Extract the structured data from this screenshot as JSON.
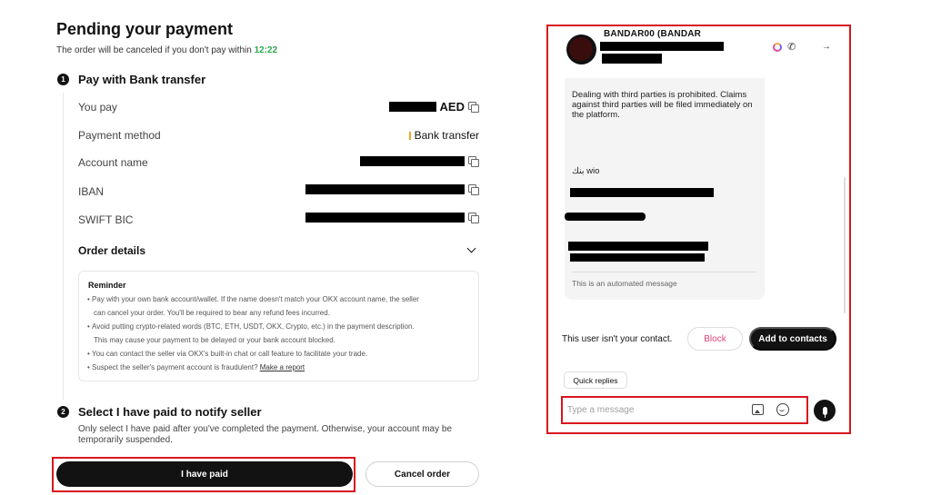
{
  "header": {
    "title": "Pending your payment",
    "subtitle_prefix": "The order will be canceled if you don't pay within",
    "countdown": "12:22"
  },
  "step1": {
    "number": "1",
    "title": "Pay with Bank transfer",
    "rows": {
      "you_pay": {
        "label": "You pay",
        "value_suffix": "AED"
      },
      "payment_method": {
        "label": "Payment method",
        "value": "Bank transfer"
      },
      "account_name": {
        "label": "Account name"
      },
      "iban": {
        "label": "IBAN"
      },
      "swift": {
        "label": "SWIFT BIC"
      }
    },
    "order_details": "Order details"
  },
  "reminder": {
    "title": "Reminder",
    "items": [
      "Pay with your own bank account/wallet. If the name doesn't match your OKX account name, the seller",
      "can cancel your order. You'll be required to bear any refund fees incurred.",
      "Avoid putting crypto-related words (BTC, ETH, USDT, OKX, Crypto, etc.) in the payment description.",
      "This may cause your payment to be delayed or your bank account blocked.",
      "You can contact the seller via OKX's built-in chat or call feature to facilitate your trade.",
      "Suspect the seller's payment account is fraudulent?"
    ],
    "report_link": "Make a report"
  },
  "step2": {
    "number": "2",
    "title": "Select I have paid to notify seller",
    "description": "Only select I have paid after you've completed the payment. Otherwise, your account may be temporarily suspended."
  },
  "actions": {
    "paid": "I have paid",
    "cancel": "Cancel order"
  },
  "chat": {
    "name": "BANDAR00 (BANDAR",
    "message": "Dealing with third parties is prohibited. Claims against third parties will be filed immediately on the platform.",
    "bank_line": "بنك wio",
    "auto_note": "This is an automated message",
    "contact_notice": "This user isn't your contact.",
    "block": "Block",
    "add_contact": "Add to contacts",
    "quick_replies": "Quick replies",
    "input_placeholder": "Type a message",
    "icons": [
      "okx-ring-icon",
      "phone-icon",
      "arrow-icon",
      "image-icon",
      "emoji-icon",
      "mic-icon"
    ]
  },
  "colors": {
    "accent_green": "#2fa84f",
    "highlight_red": "#d9161d",
    "block_pink": "#e0457b",
    "payment_method_marker": "#f5a623"
  }
}
